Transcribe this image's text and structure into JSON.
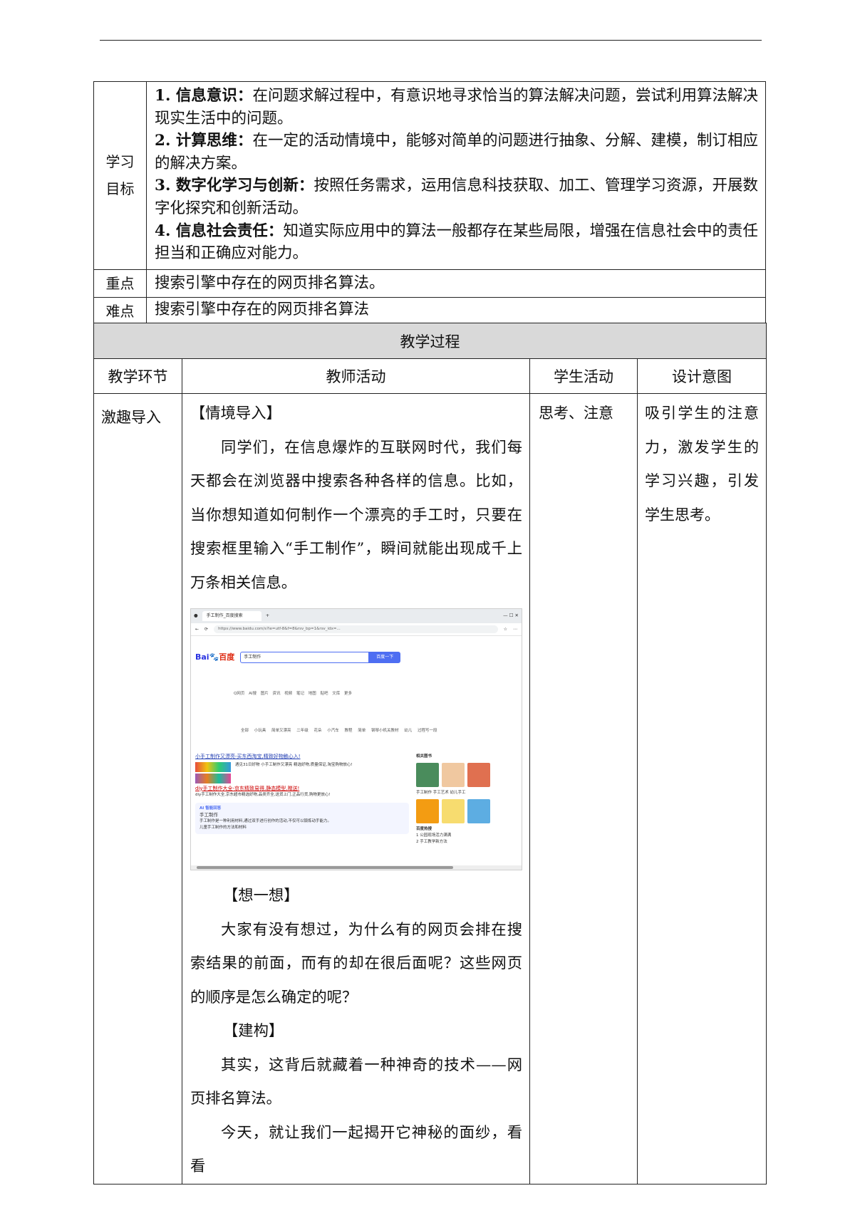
{
  "goals_section": {
    "label": "学习\n目标",
    "items": [
      {
        "title": "1. 信息意识：",
        "text": "在问题求解过程中，有意识地寻求恰当的算法解决问题，尝试利用算法解决现实生活中的问题。"
      },
      {
        "title": "2. 计算思维：",
        "text": "在一定的活动情境中，能够对简单的问题进行抽象、分解、建模，制订相应的解决方案。"
      },
      {
        "title": "3. 数字化学习与创新：",
        "text": "按照任务需求，运用信息科技获取、加工、管理学习资源，开展数字化探究和创新活动。"
      },
      {
        "title": "4. 信息社会责任：",
        "text": "知道实际应用中的算法一般都存在某些局限，增强在信息社会中的责任担当和正确应对能力。"
      }
    ]
  },
  "key_point": {
    "label": "重点",
    "text": "搜索引擎中存在的网页排名算法。"
  },
  "difficult_point": {
    "label": "难点",
    "text": "搜索引擎中存在的网页排名算法"
  },
  "process": {
    "banner": "教学过程",
    "headers": [
      "教学环节",
      "教师活动",
      "学生活动",
      "设计意图"
    ],
    "stage": "激趣导入",
    "teacher": {
      "heading1": "【情境导入】",
      "para1": "同学们，在信息爆炸的互联网时代，我们每天都会在浏览器中搜索各种各样的信息。比如，当你想知道如何制作一个漂亮的手工时，只要在搜索框里输入“手工制作”，瞬间就能出现成千上万条相关信息。",
      "heading2": "【想一想】",
      "para2": "大家有没有想过，为什么有的网页会排在搜索结果的前面，而有的却在很后面呢？这些网页的顺序是怎么确定的呢？",
      "heading3": "【建构】",
      "para3": "其实，这背后就藏着一种神奇的技术——网页排名算法。",
      "para4": "今天，就让我们一起揭开它神秘的面纱，看看"
    },
    "student": "思考、注意",
    "intent": "吸引学生的注意力，激发学生的学习兴趣，引发学生思考。"
  },
  "screenshot": {
    "tab_title": "手工制作_百度搜索",
    "url": "https://www.baidu.com/s?ie=utf-8&f=8&rsv_bp=1&rsv_idx=...",
    "logo_main": "Bai",
    "logo_tail": "百度",
    "query": "手工制作",
    "button": "百度一下",
    "navs": "Q网页 AI搜 图片 资讯 视频 笔记 地图 贴吧 文库 更多",
    "cats": "全部 小玩具 简单又漂亮 二年级 花朵 小汽车 教程 简单 钢琴小机关教材 幼儿 过程写一段",
    "result1": "小手工制作又漂亮-买东西淘宝,精致好物触心入!",
    "result1_desc": "遇见31日好物 小手工制作又漂亮 精选好物,质量保证,淘宝购物放心!",
    "result2": "diy手工制作大全-京东精致易得,静态模型,赠送!",
    "result2_desc": "diy手工制作大全,京东超市精选好物,品类齐全,送货上门,正品行货,购物更放心!",
    "ai_label": "AI 智能回答",
    "ai_title": "手工制作",
    "ai_text": "手工制作是一种利用材料,通过双手进行创作的活动,不仅可以锻炼动手能力。",
    "ai_q": "儿童手工制作的方法和材料",
    "right_title": "相关图书",
    "right_books": "手工制作 手工艺术 幼儿手工",
    "right_hot": "百度热搜",
    "right_hot1": "1 公园现场活力满满",
    "right_hot2": "2 手工教学新方法"
  }
}
